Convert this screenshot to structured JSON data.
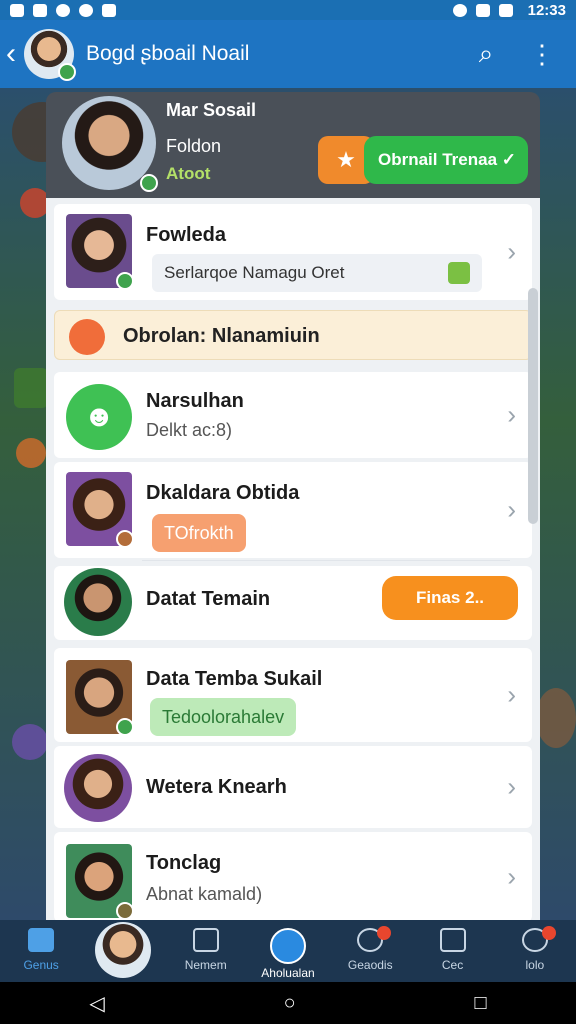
{
  "status_bar": {
    "time": "12:33"
  },
  "app_bar": {
    "back_icon": "back-arrow-icon",
    "title": "Bogd ʂboail Noail",
    "search_icon": "search-icon",
    "menu_icon": "more-vert-icon"
  },
  "profile": {
    "name": "Mar Sosail",
    "status": "Foldon",
    "tags": "Atoot",
    "add_friend_label": "Obrnail Trenaa ✓"
  },
  "list": {
    "item1": {
      "title": "Fowleda",
      "message": "Serlarqoe Namagu Oret"
    },
    "section": {
      "title": "Obrolan: Nlanamiuin"
    },
    "item2": {
      "title": "Narsulhan",
      "subtitle": "Delkt ac:8)"
    },
    "item3": {
      "title": "Dkaldara Obtida",
      "pill": "TOfrokth"
    },
    "item4": {
      "title": "Datat Temain",
      "button": "Finas 2.."
    },
    "item5": {
      "title": "Data Temba Sukail",
      "pill": "Tedoolorahalev"
    },
    "item6": {
      "title": "Wetera Knearh"
    },
    "item7": {
      "title": "Tonclag",
      "subtitle": "Abnat kamald)"
    }
  },
  "bottom_nav": {
    "home": "Genus",
    "members": "Nemem",
    "active": "Aholualan",
    "goods": "Geaodis",
    "cec": "Cec",
    "info": "lolo"
  },
  "colors": {
    "accent": "#1e74c2",
    "green": "#2fb84a",
    "orange": "#f7901e"
  }
}
